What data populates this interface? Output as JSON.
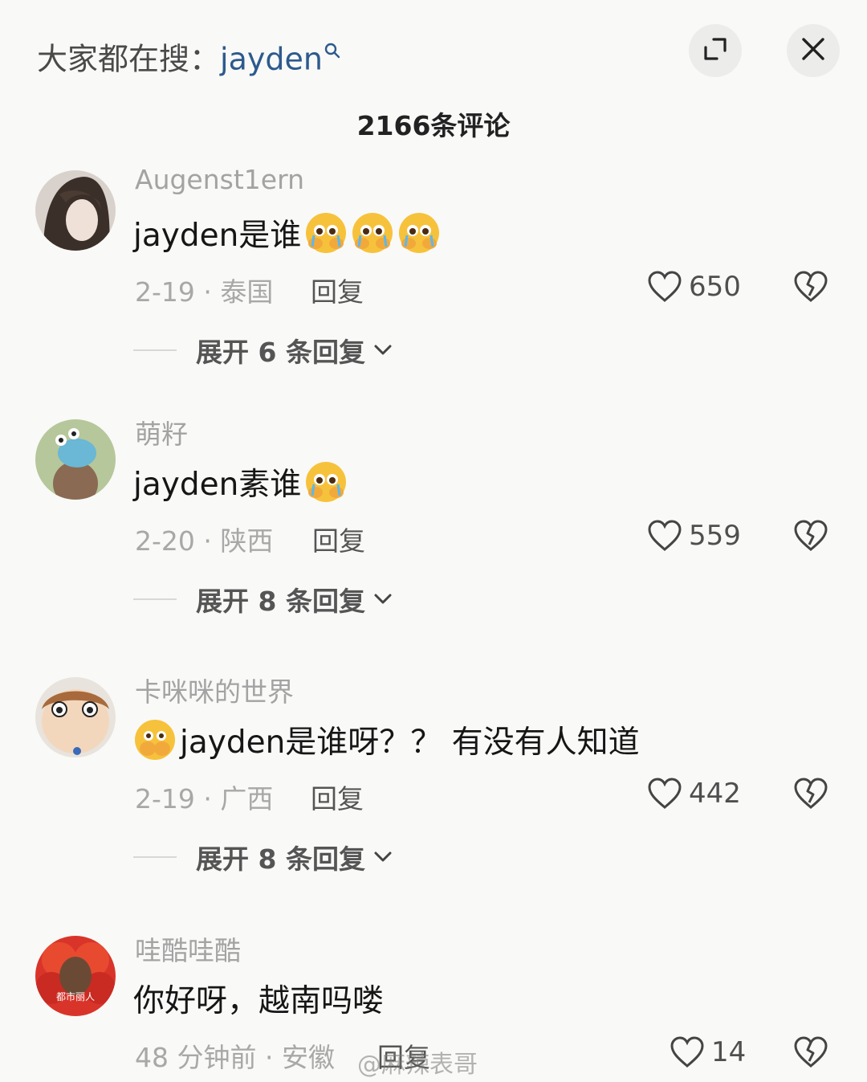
{
  "header": {
    "search_prefix": "大家都在搜：",
    "search_keyword": "jayden",
    "expand_icon": "expand-icon",
    "close_icon": "close-icon"
  },
  "comment_count": "2166条评论",
  "comments": [
    {
      "username": "Augenst1ern",
      "text": "jayden是谁",
      "emoji_count": 3,
      "meta": "2-19 · 泰国",
      "reply_label": "回复",
      "likes": "650",
      "expand_label": "展开 6 条回复"
    },
    {
      "username": "萌籽",
      "text": "jayden素谁",
      "emoji_count": 1,
      "meta": "2-20 · 陕西",
      "reply_label": "回复",
      "likes": "559",
      "expand_label": "展开 8 条回复"
    },
    {
      "username": "卡咪咪的世界",
      "text": "jayden是谁呀？？ 有没有人知道",
      "emoji_count": 1,
      "meta": "2-19 · 广西",
      "reply_label": "回复",
      "likes": "442",
      "expand_label": "展开 8 条回复"
    },
    {
      "username": "哇酷哇酷",
      "text": "你好呀，越南吗喽",
      "avatar_text": "都市丽人",
      "meta": "48 分钟前 · 安徽",
      "reply_label": "回复",
      "likes": "14"
    }
  ],
  "watermark": "@麻辣表哥",
  "colors": {
    "background": "#f9f9f7",
    "keyword": "#2d5a8e",
    "muted": "#a3a3a3"
  }
}
